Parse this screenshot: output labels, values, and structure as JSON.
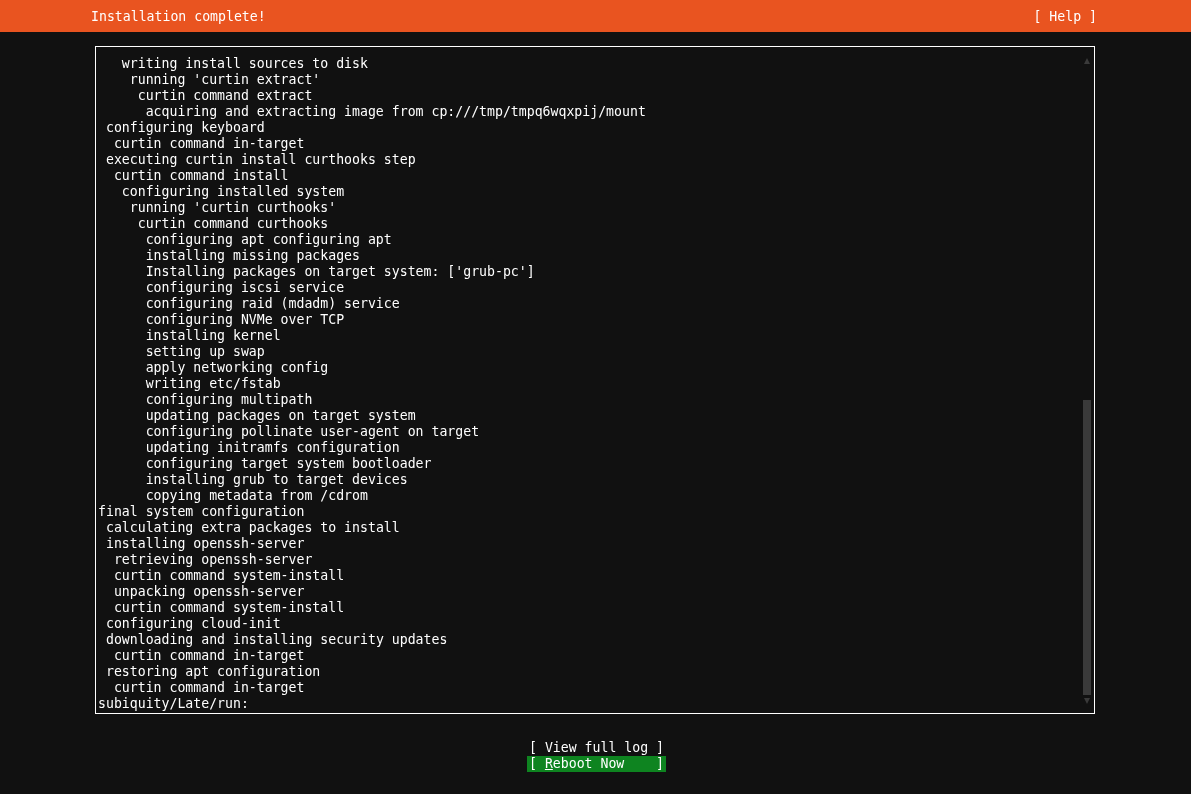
{
  "header": {
    "title": "Installation complete!",
    "help_button": "[ Help ]"
  },
  "log": {
    "entries": [
      {
        "children": [
          {
            "children": [
              {
                "children": [
                  {
                    "text": "writing install sources to disk",
                    "children": [
                      {
                        "text": "running 'curtin extract'",
                        "children": [
                          {
                            "text": "curtin command extract",
                            "children": [
                              {
                                "text": "acquiring and extracting image from cp:///tmp/tmpq6wqxpij/mount"
                              }
                            ]
                          }
                        ]
                      }
                    ]
                  }
                ]
              }
            ]
          },
          {
            "text": "configuring keyboard",
            "children": [
              {
                "text": "curtin command in-target"
              }
            ]
          },
          {
            "text": "executing curtin install curthooks step",
            "children": [
              {
                "text": "curtin command install",
                "children": [
                  {
                    "text": "configuring installed system",
                    "children": [
                      {
                        "text": "running 'curtin curthooks'",
                        "children": [
                          {
                            "text": "curtin command curthooks",
                            "children": [
                              {
                                "text": "configuring apt configuring apt"
                              },
                              {
                                "text": "installing missing packages"
                              },
                              {
                                "text": "Installing packages on target system: ['grub-pc']"
                              },
                              {
                                "text": "configuring iscsi service"
                              },
                              {
                                "text": "configuring raid (mdadm) service"
                              },
                              {
                                "text": "configuring NVMe over TCP"
                              },
                              {
                                "text": "installing kernel"
                              },
                              {
                                "text": "setting up swap"
                              },
                              {
                                "text": "apply networking config"
                              },
                              {
                                "text": "writing etc/fstab"
                              },
                              {
                                "text": "configuring multipath"
                              },
                              {
                                "text": "updating packages on target system"
                              },
                              {
                                "text": "configuring pollinate user-agent on target"
                              },
                              {
                                "text": "updating initramfs configuration"
                              },
                              {
                                "text": "configuring target system bootloader"
                              },
                              {
                                "text": "installing grub to target devices"
                              },
                              {
                                "text": "copying metadata from /cdrom"
                              }
                            ]
                          }
                        ]
                      }
                    ]
                  }
                ]
              }
            ]
          }
        ]
      },
      {
        "text": "final system configuration",
        "children": [
          {
            "text": "calculating extra packages to install"
          },
          {
            "text": "installing openssh-server",
            "children": [
              {
                "text": "retrieving openssh-server"
              },
              {
                "text": "curtin command system-install"
              },
              {
                "text": "unpacking openssh-server"
              },
              {
                "text": "curtin command system-install"
              }
            ]
          },
          {
            "text": "configuring cloud-init"
          },
          {
            "text": "downloading and installing security updates",
            "children": [
              {
                "text": "curtin command in-target"
              }
            ]
          },
          {
            "text": "restoring apt configuration",
            "children": [
              {
                "text": "curtin command in-target"
              }
            ]
          }
        ]
      },
      {
        "text": "subiquity/Late/run:"
      }
    ]
  },
  "buttons": [
    {
      "kind": "plain",
      "label_before": "[ View full log ]"
    },
    {
      "kind": "focused",
      "label_before": "[ ",
      "hotkey": "R",
      "label_after": "eboot Now    ]"
    }
  ]
}
